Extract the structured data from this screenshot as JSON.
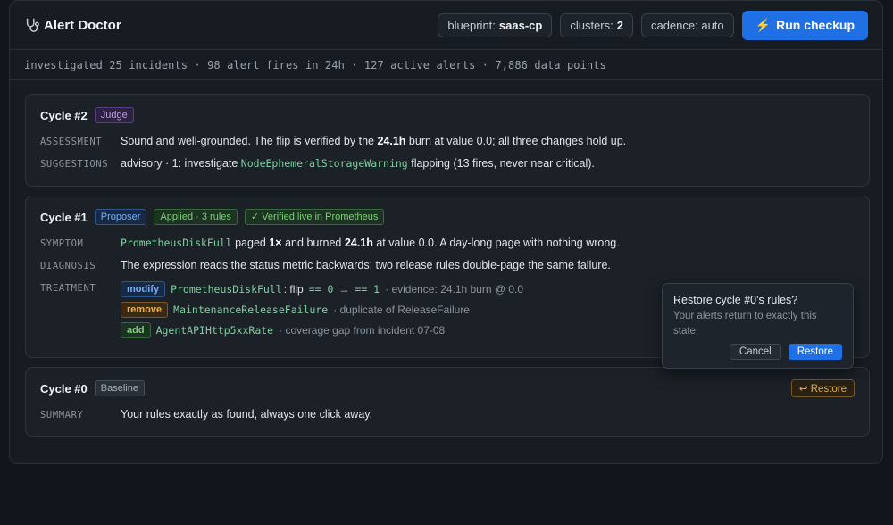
{
  "header": {
    "app_title": "Alert Doctor",
    "blueprint_label": "blueprint:",
    "blueprint_value": "saas-cp",
    "clusters_label": "clusters:",
    "clusters_value": "2",
    "cadence_label": "cadence: auto",
    "run_label": "Run checkup"
  },
  "summary_bar": "investigated 25 incidents · 98 alert fires in 24h · 127 active alerts · 7,886 data points",
  "cycle2": {
    "title": "Cycle #2",
    "badge": "Judge",
    "assessment_label": "ASSESSMENT",
    "assessment_pre": "Sound and well-grounded. The flip is verified by the",
    "assessment_bold": "24.1h",
    "assessment_post": "burn at value 0.0; all three changes hold up.",
    "suggestions_label": "SUGGESTIONS",
    "suggestions_pre": "advisory · 1: investigate",
    "suggestions_code": "NodeEphemeralStorageWarning",
    "suggestions_post": "flapping (13 fires, never near critical)."
  },
  "cycle1": {
    "title": "Cycle #1",
    "badge_proposer": "Proposer",
    "badge_applied": "Applied · 3 rules",
    "badge_verified": "✓ Verified live in Prometheus",
    "symptom_label": "SYMPTOM",
    "symptom_code": "PrometheusDiskFull",
    "symptom_t1": "paged",
    "symptom_b1": "1×",
    "symptom_t2": "and burned",
    "symptom_b2": "24.1h",
    "symptom_t3": "at value 0.0. A day-long page with nothing wrong.",
    "diagnosis_label": "DIAGNOSIS",
    "diagnosis_text": "The expression reads the status metric backwards; two release rules double-page the same failure.",
    "treatment_label": "TREATMENT",
    "treatments": [
      {
        "op": "modify",
        "rule": "PrometheusDiskFull",
        "sep": ": flip",
        "from": "== 0",
        "arrow": "→",
        "to": "== 1",
        "note": "· evidence: 24.1h burn @ 0.0"
      },
      {
        "op": "remove",
        "rule": "MaintenanceReleaseFailure",
        "note": "· duplicate of ReleaseFailure"
      },
      {
        "op": "add",
        "rule": "AgentAPIHttp5xxRate",
        "note": "· coverage gap from incident 07-08"
      }
    ]
  },
  "cycle0": {
    "title": "Cycle #0",
    "badge": "Baseline",
    "restore_label": "↩ Restore",
    "summary_label": "SUMMARY",
    "summary_text": "Your rules exactly as found, always one click away."
  },
  "popover": {
    "title": "Restore cycle #0's rules?",
    "desc": "Your alerts return to exactly this state.",
    "cancel": "Cancel",
    "confirm": "Restore"
  },
  "colors": {
    "accent": "#1f6fe5",
    "judge": "#c79af5",
    "proposer": "#78aff5",
    "applied": "#7fcf7a",
    "remove": "#f0b048"
  }
}
